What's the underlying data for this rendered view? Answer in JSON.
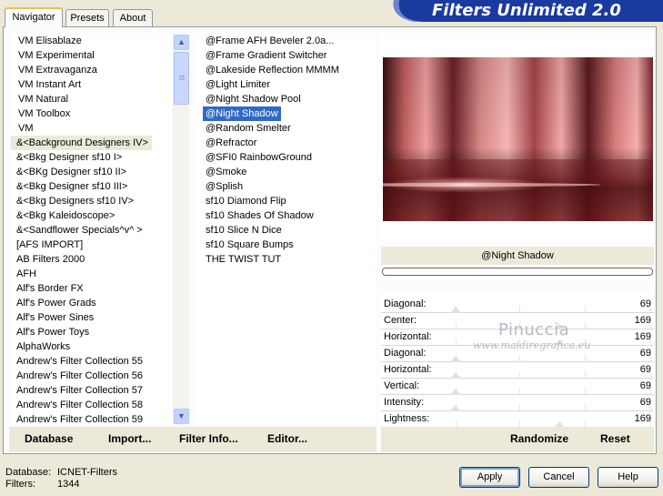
{
  "window": {
    "title": "Filters Unlimited 2.0"
  },
  "tabs": [
    {
      "label": "Navigator",
      "active": true
    },
    {
      "label": "Presets",
      "active": false
    },
    {
      "label": "About",
      "active": false
    }
  ],
  "categories": [
    "VM Elisablaze",
    "VM Experimental",
    "VM Extravaganza",
    "VM Instant Art",
    "VM Natural",
    "VM Toolbox",
    "VM",
    "&<Background Designers IV>",
    "&<Bkg Designer sf10 I>",
    "&<BKg Designer sf10 II>",
    "&<Bkg Designer sf10 III>",
    "&<Bkg Designers sf10 IV>",
    "&<Bkg Kaleidoscope>",
    "&<Sandflower Specials^v^ >",
    "[AFS IMPORT]",
    "AB Filters 2000",
    "AFH",
    "Alf's Border FX",
    "Alf's Power Grads",
    "Alf's Power Sines",
    "Alf's Power Toys",
    "AlphaWorks",
    "Andrew's Filter Collection 55",
    "Andrew's Filter Collection 56",
    "Andrew's Filter Collection 57",
    "Andrew's Filter Collection 58",
    "Andrew's Filter Collection 59"
  ],
  "filters": [
    "@Frame AFH Beveler 2.0a...",
    "@Frame Gradient Switcher",
    "@Lakeside Reflection MMMM",
    "@Light Limiter",
    "@Night Shadow Pool",
    "@Night Shadow",
    "@Random Smelter",
    "@Refractor",
    "@SFI0 RainbowGround",
    "@Smoke",
    "@Splish",
    "sf10 Diamond Flip",
    "sf10 Shades Of Shadow",
    "sf10 Slice N Dice",
    "sf10 Square Bumps",
    "THE TWIST TUT"
  ],
  "selected_filter": "@Night Shadow",
  "progress": 0,
  "params": [
    {
      "label": "Diagonal:",
      "value": "69",
      "knob": 69
    },
    {
      "label": "Center:",
      "value": "169",
      "knob": 169
    },
    {
      "label": "Horizontal:",
      "value": "169",
      "knob": 169
    },
    {
      "label": "Diagonal:",
      "value": "69",
      "knob": 69
    },
    {
      "label": "Horizontal:",
      "value": "69",
      "knob": 69
    },
    {
      "label": "Vertical:",
      "value": "69",
      "knob": 69
    },
    {
      "label": "Intensity:",
      "value": "69",
      "knob": 69
    },
    {
      "label": "Lightness:",
      "value": "169",
      "knob": 169
    }
  ],
  "watermark": {
    "name": "Pinuccia",
    "site": "www.maidiregrafica.eu"
  },
  "left_buttons": {
    "database": "Database",
    "import": "Import...",
    "filter_info": "Filter Info...",
    "editor": "Editor..."
  },
  "right_buttons": {
    "randomize": "Randomize",
    "reset": "Reset"
  },
  "status": {
    "database_label": "Database:",
    "database_value": "ICNET-Filters",
    "filters_label": "Filters:",
    "filters_value": "1344"
  },
  "dialog_buttons": {
    "apply": "Apply",
    "cancel": "Cancel",
    "help": "Help"
  },
  "colors": {
    "title_bar": "#1c3b9c",
    "selection": "#316ac5",
    "apply_focus": "#7da2ce"
  }
}
